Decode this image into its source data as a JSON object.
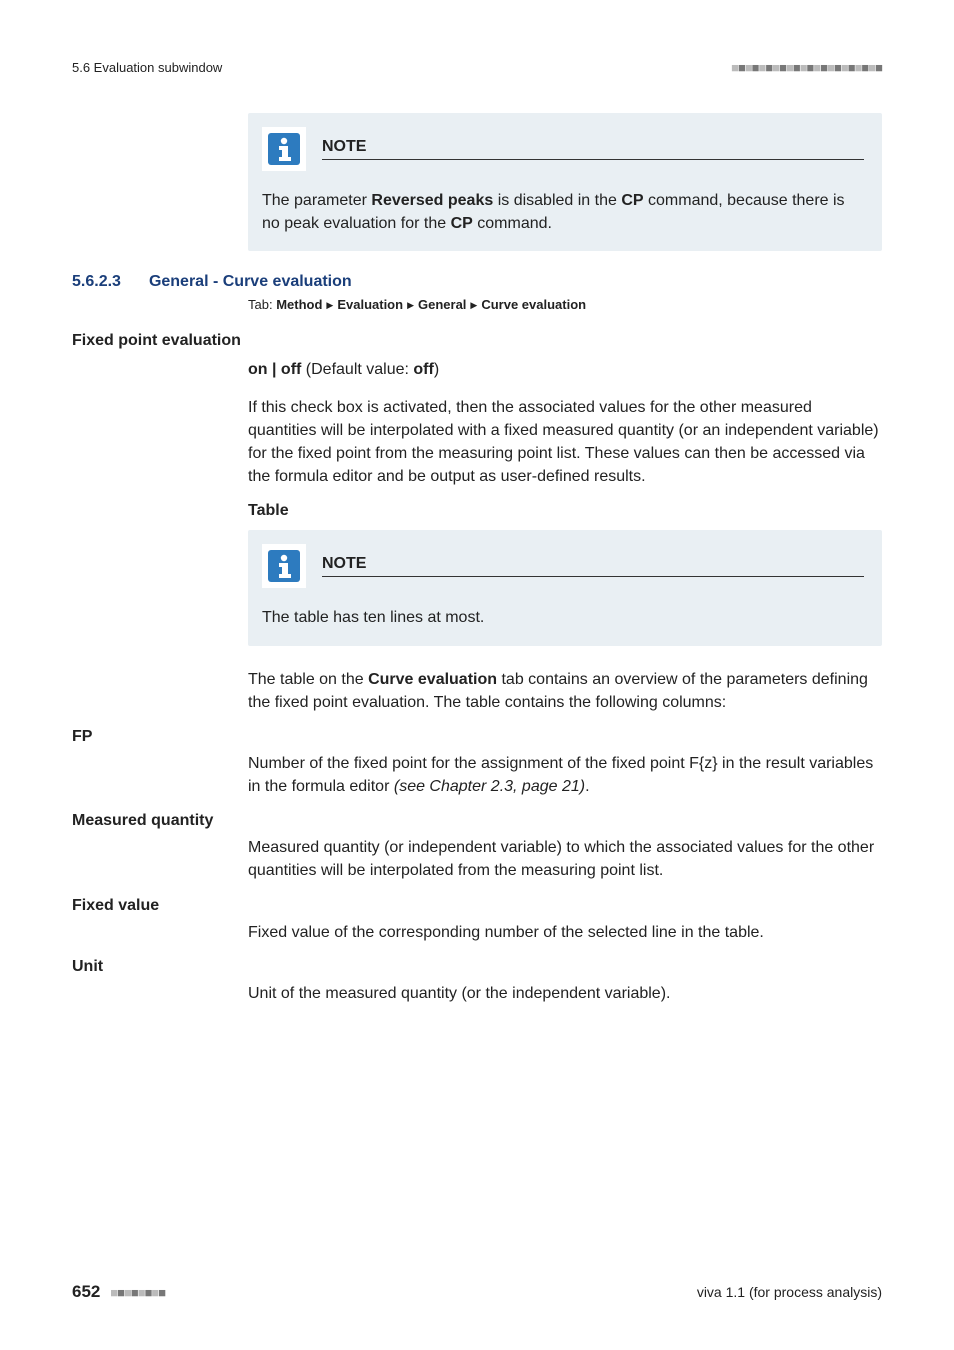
{
  "header": {
    "section_ref": "5.6 Evaluation subwindow"
  },
  "note1": {
    "title": "NOTE",
    "body_pre": "The parameter ",
    "body_bold1": "Reversed peaks",
    "body_mid1": " is disabled in the ",
    "body_bold2": "CP",
    "body_mid2": " command, because there is no peak evaluation for the ",
    "body_bold3": "CP",
    "body_post": " command."
  },
  "section": {
    "num": "5.6.2.3",
    "title": "General - Curve evaluation",
    "tab_label": "Tab: ",
    "crumbs": [
      "Method",
      "Evaluation",
      "General",
      "Curve evaluation"
    ]
  },
  "fixed_point": {
    "heading": "Fixed point evaluation",
    "onoff_pre": "on | off",
    "onoff_mid": " (Default value: ",
    "onoff_def": "off",
    "onoff_post": ")",
    "desc": "If this check box is activated, then the associated values for the other measured quantities will be interpolated with a fixed measured quantity (or an independent variable) for the fixed point from the measuring point list. These values can then be accessed via the formula editor and be output as user-defined results."
  },
  "table": {
    "heading": "Table",
    "note_title": "NOTE",
    "note_body": "The table has ten lines at most.",
    "intro_pre": "The table on the ",
    "intro_bold": "Curve evaluation",
    "intro_post": " tab contains an overview of the parameters defining the fixed point evaluation. The table contains the following columns:"
  },
  "defs": {
    "fp_term": "FP",
    "fp_body_pre": "Number of the fixed point for the assignment of the fixed point F{z} in the result variables in the formula editor ",
    "fp_body_italic": "(see Chapter 2.3, page 21)",
    "fp_body_post": ".",
    "mq_term": "Measured quantity",
    "mq_body": "Measured quantity (or independent variable) to which the associated values for the other quantities will be interpolated from the measuring point list.",
    "fv_term": "Fixed value",
    "fv_body": "Fixed value of the corresponding number of the selected line in the table.",
    "unit_term": "Unit",
    "unit_body": "Unit of the measured quantity (or the independent variable)."
  },
  "footer": {
    "page": "652",
    "product": "viva 1.1 (for process analysis)"
  }
}
